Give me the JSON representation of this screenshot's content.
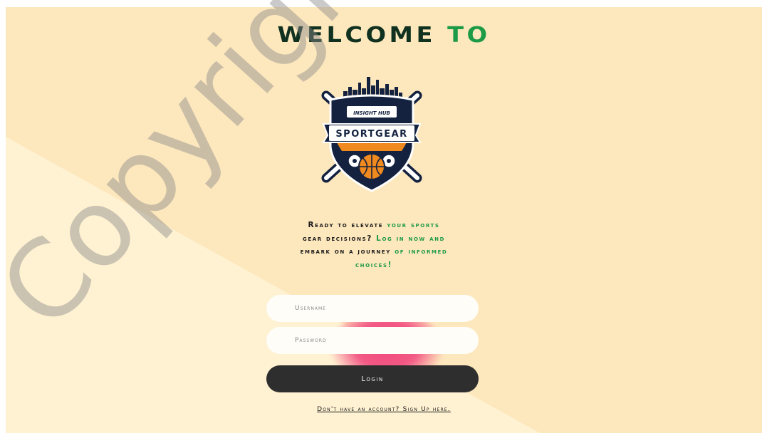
{
  "header": {
    "title_part1": "WELCOME",
    "title_part2": "TO"
  },
  "logo": {
    "top_text": "INSIGHT HUB",
    "main_text": "SPORTGEAR"
  },
  "tagline": {
    "p1": "Ready to elevate ",
    "p2": "your sports",
    "p3": "gear decisions? ",
    "p4": "Log in now and",
    "p5": "embark on a journey ",
    "p6": "of informed",
    "p7": "choices!"
  },
  "form": {
    "username_placeholder": "Username",
    "password_placeholder": "Password",
    "login_label": "Login"
  },
  "footer": {
    "signup_link": "Don't have an account? Sign Up here."
  },
  "watermark": {
    "text": "Copyright UKM"
  },
  "colors": {
    "background": "#fde7bd",
    "accent_green": "#1c9a46",
    "button_dark": "#2e2e2e",
    "logo_navy": "#14223f",
    "logo_orange": "#f08a1e"
  }
}
